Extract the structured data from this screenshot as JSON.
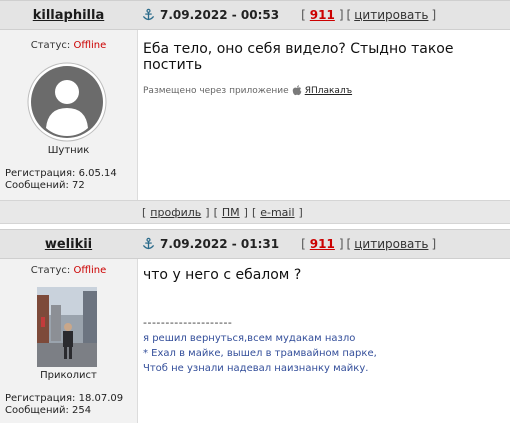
{
  "posts": [
    {
      "author": "killaphilla",
      "date": "7.09.2022 - 00:53",
      "post_number": "911",
      "quote_label": "цитировать",
      "status_label": "Статус:",
      "status_value": "Offline",
      "rank": "Шутник",
      "reg": "Регистрация: 6.05.14",
      "msgs": "Сообщений: 72",
      "message": "Еба тело, оно себя видело? Стыдно такое постить",
      "via_text": "Размещено через приложение",
      "via_app": "ЯПлакалъ"
    },
    {
      "author": "welikii",
      "date": "7.09.2022 - 01:31",
      "post_number": "911",
      "quote_label": "цитировать",
      "status_label": "Статус:",
      "status_value": "Offline",
      "rank": "Приколист",
      "reg": "Регистрация: 18.07.09",
      "msgs": "Сообщений: 254",
      "message": "что у него с ебалом ?",
      "signature_divider": "--------------------",
      "signature": [
        "я решил вернуться,всем мудакам назло",
        "* Ехал в майке, вышел в трамвайном парке,",
        "Чтоб не узнали надевал наизнанку майку."
      ]
    }
  ],
  "footer": {
    "profile": "профиль",
    "pm": "ПМ",
    "email": "e-mail"
  },
  "colors": {
    "header_bg": "#e4e4e4",
    "left_bg": "#f2f2f2",
    "offline": "#cc0000",
    "signature": "#334e9a"
  }
}
